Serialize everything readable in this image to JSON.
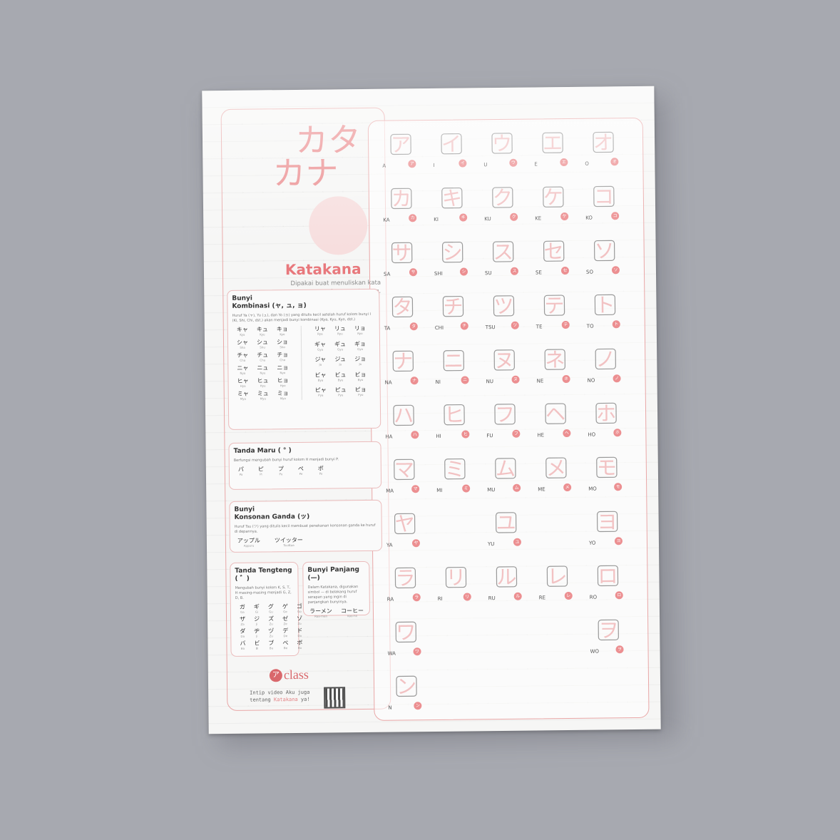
{
  "title_kana": [
    "カタ",
    "カナ"
  ],
  "title_label": "Katakana",
  "tagline": "Dipakai buat menuliskan kata serapan asing, non-Jepang.",
  "sections": {
    "combo": {
      "title_line1": "Bunyi",
      "title_line2": "Kombinasi (ャ, ュ, ョ)",
      "desc": "Huruf Ya (ャ), Yu (ュ), dan Yo (ョ) yang ditulis kecil setelah huruf kolom bunyi I (Ki, Shi, Chi, dst.) akan menjadi bunyi kombinasi (Kya, Kyu, Kyo, dst.)",
      "left": [
        {
          "k": "キャ",
          "r": "Kya"
        },
        {
          "k": "キュ",
          "r": "Kyu"
        },
        {
          "k": "キョ",
          "r": "Kyo"
        },
        {
          "k": "シャ",
          "r": "Sha"
        },
        {
          "k": "シュ",
          "r": "Shu"
        },
        {
          "k": "ショ",
          "r": "Sho"
        },
        {
          "k": "チャ",
          "r": "Cha"
        },
        {
          "k": "チュ",
          "r": "Chu"
        },
        {
          "k": "チョ",
          "r": "Cho"
        },
        {
          "k": "ニャ",
          "r": "Nya"
        },
        {
          "k": "ニュ",
          "r": "Nyu"
        },
        {
          "k": "ニョ",
          "r": "Nyo"
        },
        {
          "k": "ヒャ",
          "r": "Hya"
        },
        {
          "k": "ヒュ",
          "r": "Hyu"
        },
        {
          "k": "ヒョ",
          "r": "Hyo"
        },
        {
          "k": "ミャ",
          "r": "Mya"
        },
        {
          "k": "ミュ",
          "r": "Myu"
        },
        {
          "k": "ミョ",
          "r": "Myo"
        }
      ],
      "right": [
        {
          "k": "リャ",
          "r": "Rya"
        },
        {
          "k": "リュ",
          "r": "Ryu"
        },
        {
          "k": "リョ",
          "r": "Ryo"
        },
        {
          "k": "ギャ",
          "r": "Gya"
        },
        {
          "k": "ギュ",
          "r": "Gyu"
        },
        {
          "k": "ギョ",
          "r": "Gyo"
        },
        {
          "k": "ジャ",
          "r": "Ja"
        },
        {
          "k": "ジュ",
          "r": "Ju"
        },
        {
          "k": "ジョ",
          "r": "Jo"
        },
        {
          "k": "ビャ",
          "r": "Bya"
        },
        {
          "k": "ビュ",
          "r": "Byu"
        },
        {
          "k": "ビョ",
          "r": "Byo"
        },
        {
          "k": "ピャ",
          "r": "Pya"
        },
        {
          "k": "ピュ",
          "r": "Pyu"
        },
        {
          "k": "ピョ",
          "r": "Pyo"
        }
      ]
    },
    "maru": {
      "title": "Tanda Maru ( ° )",
      "desc": "Berfungsi mengubah bunyi huruf kolom H menjadi bunyi P.",
      "items": [
        {
          "k": "パ",
          "r": "Pa"
        },
        {
          "k": "ピ",
          "r": "Pi"
        },
        {
          "k": "プ",
          "r": "Pu"
        },
        {
          "k": "ペ",
          "r": "Pe"
        },
        {
          "k": "ポ",
          "r": "Po"
        }
      ]
    },
    "ganda": {
      "title_line1": "Bunyi",
      "title_line2": "Konsonan Ganda (ッ)",
      "desc": "Huruf Tsu (ツ) yang ditulis kecil membuat penekanan konsonan ganda ke huruf di depannya.",
      "items": [
        {
          "k": "アップル",
          "r": "Appuru"
        },
        {
          "k": "ツイッター",
          "r": "Tsuittaa"
        }
      ]
    },
    "tengteng": {
      "title": "Tanda Tengteng ( ゛)",
      "desc": "Mengubah bunyi kolom K, S, T, H masing-masing menjadi G, Z, D, B.",
      "items": [
        {
          "k": "ガ",
          "r": "Ga"
        },
        {
          "k": "ギ",
          "r": "Gi"
        },
        {
          "k": "グ",
          "r": "Gu"
        },
        {
          "k": "ゲ",
          "r": "Ge"
        },
        {
          "k": "ゴ",
          "r": "Go"
        },
        {
          "k": "ザ",
          "r": "Za"
        },
        {
          "k": "ジ",
          "r": "Ji"
        },
        {
          "k": "ズ",
          "r": "Zu"
        },
        {
          "k": "ゼ",
          "r": "Ze"
        },
        {
          "k": "ゾ",
          "r": "Zo"
        },
        {
          "k": "ダ",
          "r": "Da"
        },
        {
          "k": "ヂ",
          "r": "Ji"
        },
        {
          "k": "ヅ",
          "r": "Zu"
        },
        {
          "k": "デ",
          "r": "De"
        },
        {
          "k": "ド",
          "r": "Do"
        },
        {
          "k": "バ",
          "r": "Ba"
        },
        {
          "k": "ビ",
          "r": "Bi"
        },
        {
          "k": "ブ",
          "r": "Bu"
        },
        {
          "k": "ベ",
          "r": "Be"
        },
        {
          "k": "ボ",
          "r": "Bo"
        }
      ]
    },
    "panjang": {
      "title": "Bunyi Panjang (—)",
      "desc": "Dalam Katakana, digunakan simbol — di belakang huruf serapan yang ingin di panjangkan bunyinya.",
      "items": [
        {
          "k": "ラーメン",
          "r": "Raa-men"
        },
        {
          "k": "コーヒー",
          "r": "Koo-hii"
        }
      ]
    }
  },
  "kana": [
    {
      "rom": "A",
      "k": "ア"
    },
    {
      "rom": "I",
      "k": "イ"
    },
    {
      "rom": "U",
      "k": "ウ"
    },
    {
      "rom": "E",
      "k": "エ"
    },
    {
      "rom": "O",
      "k": "オ"
    },
    {
      "rom": "KA",
      "k": "カ"
    },
    {
      "rom": "KI",
      "k": "キ"
    },
    {
      "rom": "KU",
      "k": "ク"
    },
    {
      "rom": "KE",
      "k": "ケ"
    },
    {
      "rom": "KO",
      "k": "コ"
    },
    {
      "rom": "SA",
      "k": "サ"
    },
    {
      "rom": "SHI",
      "k": "シ"
    },
    {
      "rom": "SU",
      "k": "ス"
    },
    {
      "rom": "SE",
      "k": "セ"
    },
    {
      "rom": "SO",
      "k": "ソ"
    },
    {
      "rom": "TA",
      "k": "タ"
    },
    {
      "rom": "CHI",
      "k": "チ"
    },
    {
      "rom": "TSU",
      "k": "ツ"
    },
    {
      "rom": "TE",
      "k": "テ"
    },
    {
      "rom": "TO",
      "k": "ト"
    },
    {
      "rom": "NA",
      "k": "ナ"
    },
    {
      "rom": "NI",
      "k": "ニ"
    },
    {
      "rom": "NU",
      "k": "ヌ"
    },
    {
      "rom": "NE",
      "k": "ネ"
    },
    {
      "rom": "NO",
      "k": "ノ"
    },
    {
      "rom": "HA",
      "k": "ハ"
    },
    {
      "rom": "HI",
      "k": "ヒ"
    },
    {
      "rom": "FU",
      "k": "フ"
    },
    {
      "rom": "HE",
      "k": "ヘ"
    },
    {
      "rom": "HO",
      "k": "ホ"
    },
    {
      "rom": "MA",
      "k": "マ"
    },
    {
      "rom": "MI",
      "k": "ミ"
    },
    {
      "rom": "MU",
      "k": "ム"
    },
    {
      "rom": "ME",
      "k": "メ"
    },
    {
      "rom": "MO",
      "k": "モ"
    },
    {
      "rom": "YA",
      "k": "ヤ"
    },
    {
      "rom": "",
      "k": ""
    },
    {
      "rom": "YU",
      "k": "ユ"
    },
    {
      "rom": "",
      "k": ""
    },
    {
      "rom": "YO",
      "k": "ヨ"
    },
    {
      "rom": "RA",
      "k": "ラ"
    },
    {
      "rom": "RI",
      "k": "リ"
    },
    {
      "rom": "RU",
      "k": "ル"
    },
    {
      "rom": "RE",
      "k": "レ"
    },
    {
      "rom": "RO",
      "k": "ロ"
    },
    {
      "rom": "WA",
      "k": "ワ"
    },
    {
      "rom": "",
      "k": ""
    },
    {
      "rom": "",
      "k": ""
    },
    {
      "rom": "",
      "k": ""
    },
    {
      "rom": "WO",
      "k": "ヲ"
    },
    {
      "rom": "N",
      "k": "ン"
    }
  ],
  "logo": {
    "mark": "ア",
    "text": "class"
  },
  "cta": {
    "line1": "Intip video Aku juga",
    "line2_pre": "tentang ",
    "line2_hl": "Katakana",
    "line2_post": " ya!"
  },
  "colors": {
    "accent": "#ec8f91",
    "frame": "#e9a7a7",
    "title": "#e8787c"
  }
}
